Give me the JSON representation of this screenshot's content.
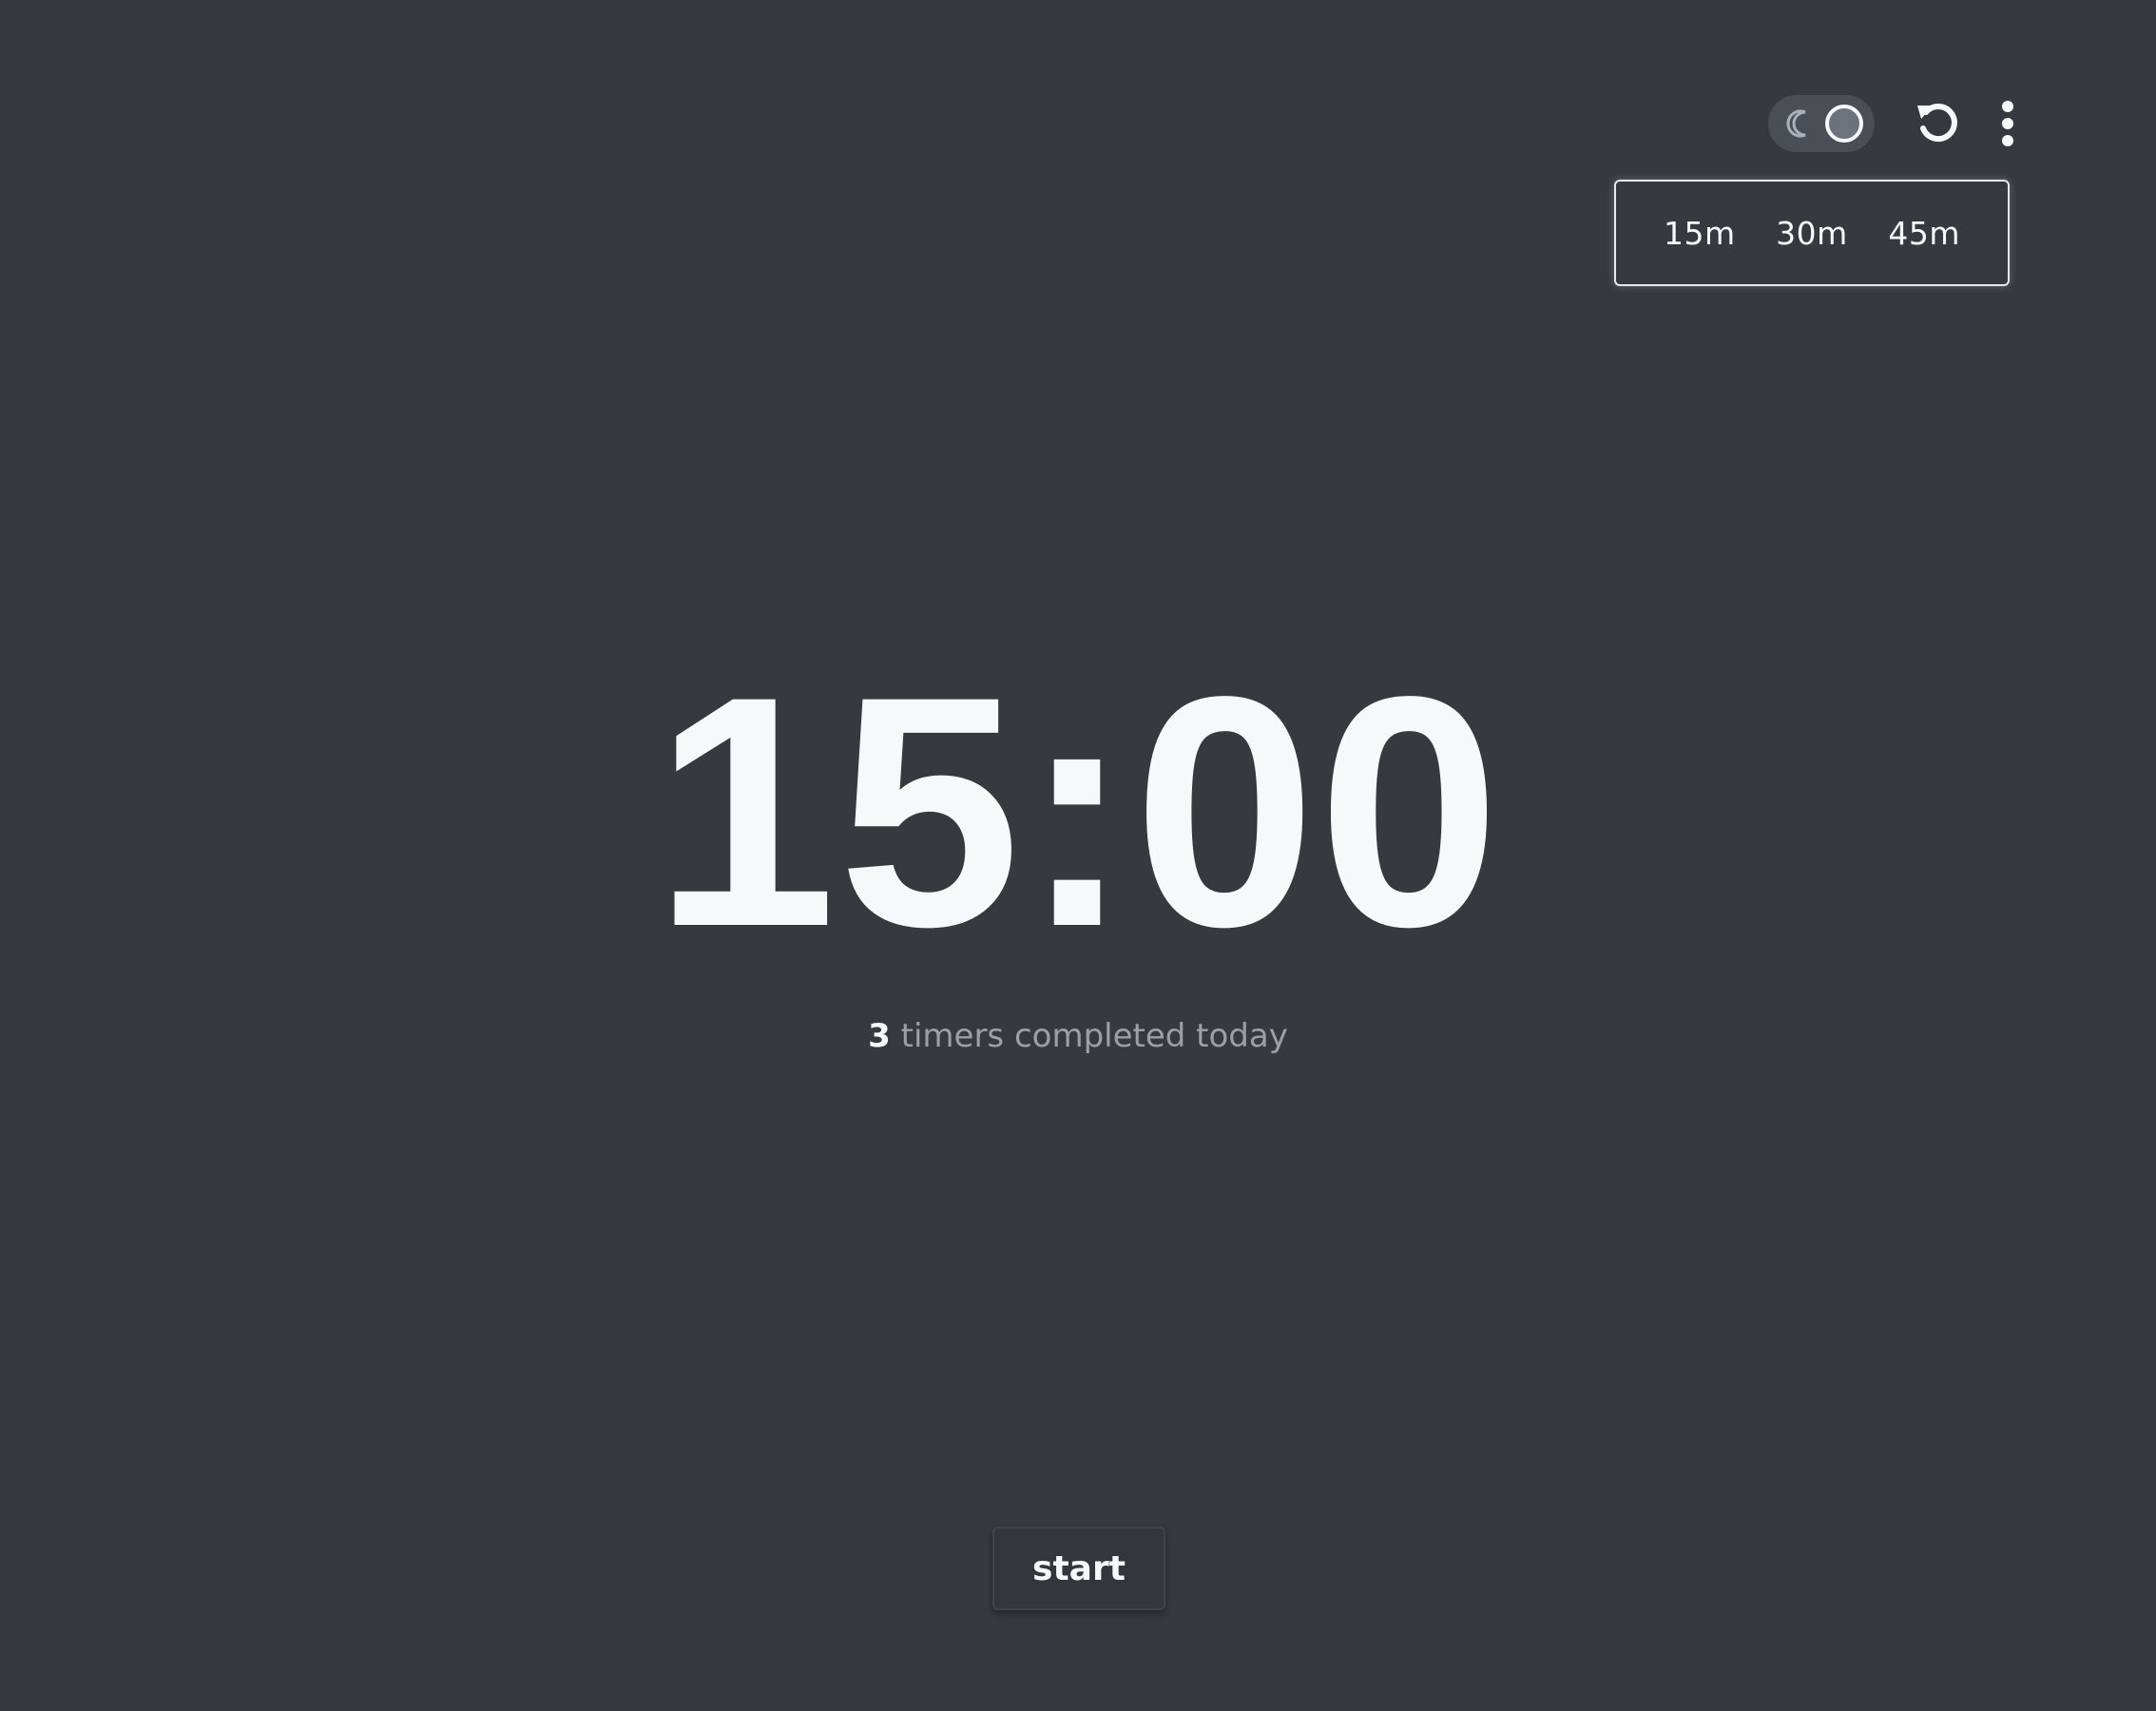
{
  "header": {
    "theme_toggle": {
      "left_icon": "moon-icon",
      "state": "dark"
    },
    "reset_icon": "reset-icon",
    "menu_icon": "more-vertical-icon"
  },
  "presets": {
    "items": [
      {
        "label": "15m"
      },
      {
        "label": "30m"
      },
      {
        "label": "45m"
      }
    ]
  },
  "timer": {
    "display": "15:00"
  },
  "stats": {
    "completed_count": "3",
    "completed_text": " timers completed today"
  },
  "actions": {
    "start_label": "start"
  },
  "colors": {
    "background": "#363a3f",
    "text": "#f6f8fa",
    "muted_text": "#9aa0a8",
    "toggle_bg": "#4a4f56"
  }
}
